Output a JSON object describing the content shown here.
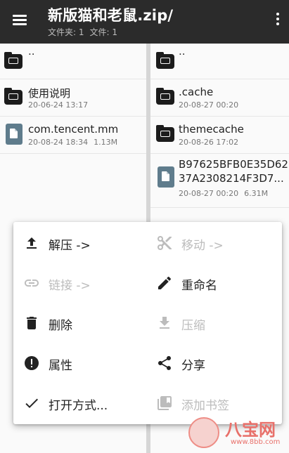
{
  "appbar": {
    "title": "新版猫和老鼠.zip/",
    "folders_label": "文件夹: 1",
    "files_label": "文件: 1",
    "menu_icon": "hamburger-menu-icon",
    "more_icon": "more-vert-icon"
  },
  "left_pane": {
    "up_label": "..",
    "items": [
      {
        "name": "使用说明",
        "date": "20-06-24 13:17",
        "size": "",
        "icon": "folder-icon"
      },
      {
        "name": "com.tencent.mm",
        "date": "20-08-24 18:34",
        "size": "1.13M",
        "icon": "file-icon"
      }
    ]
  },
  "right_pane": {
    "up_label": "..",
    "items": [
      {
        "name": ".cache",
        "date": "20-08-27 00:20",
        "icon": "folder-icon"
      },
      {
        "name": "themecache",
        "date": "20-08-26 17:02",
        "icon": "folder-icon"
      },
      {
        "name_line1": "B97625BFB0E35D62",
        "name_line2": "37A2308214F3D7...",
        "date": "20-08-27 00:20",
        "size": "6.31M",
        "icon": "file-icon"
      }
    ]
  },
  "context_menu": {
    "extract": "解压 ->",
    "move": "移动 ->",
    "link": "链接 ->",
    "rename": "重命名",
    "delete": "删除",
    "compress": "压缩",
    "properties": "属性",
    "share": "分享",
    "open_with": "打开方式...",
    "add_bookmark": "添加书签"
  },
  "watermark": {
    "text": "八宝网",
    "url": "www.8bb.com"
  },
  "colors": {
    "appbar": "#2b2b2b",
    "folder": "#1c1c1c",
    "file": "#5f7c8c",
    "disabled": "#bcbcbc",
    "watermark": "#e8706a"
  }
}
